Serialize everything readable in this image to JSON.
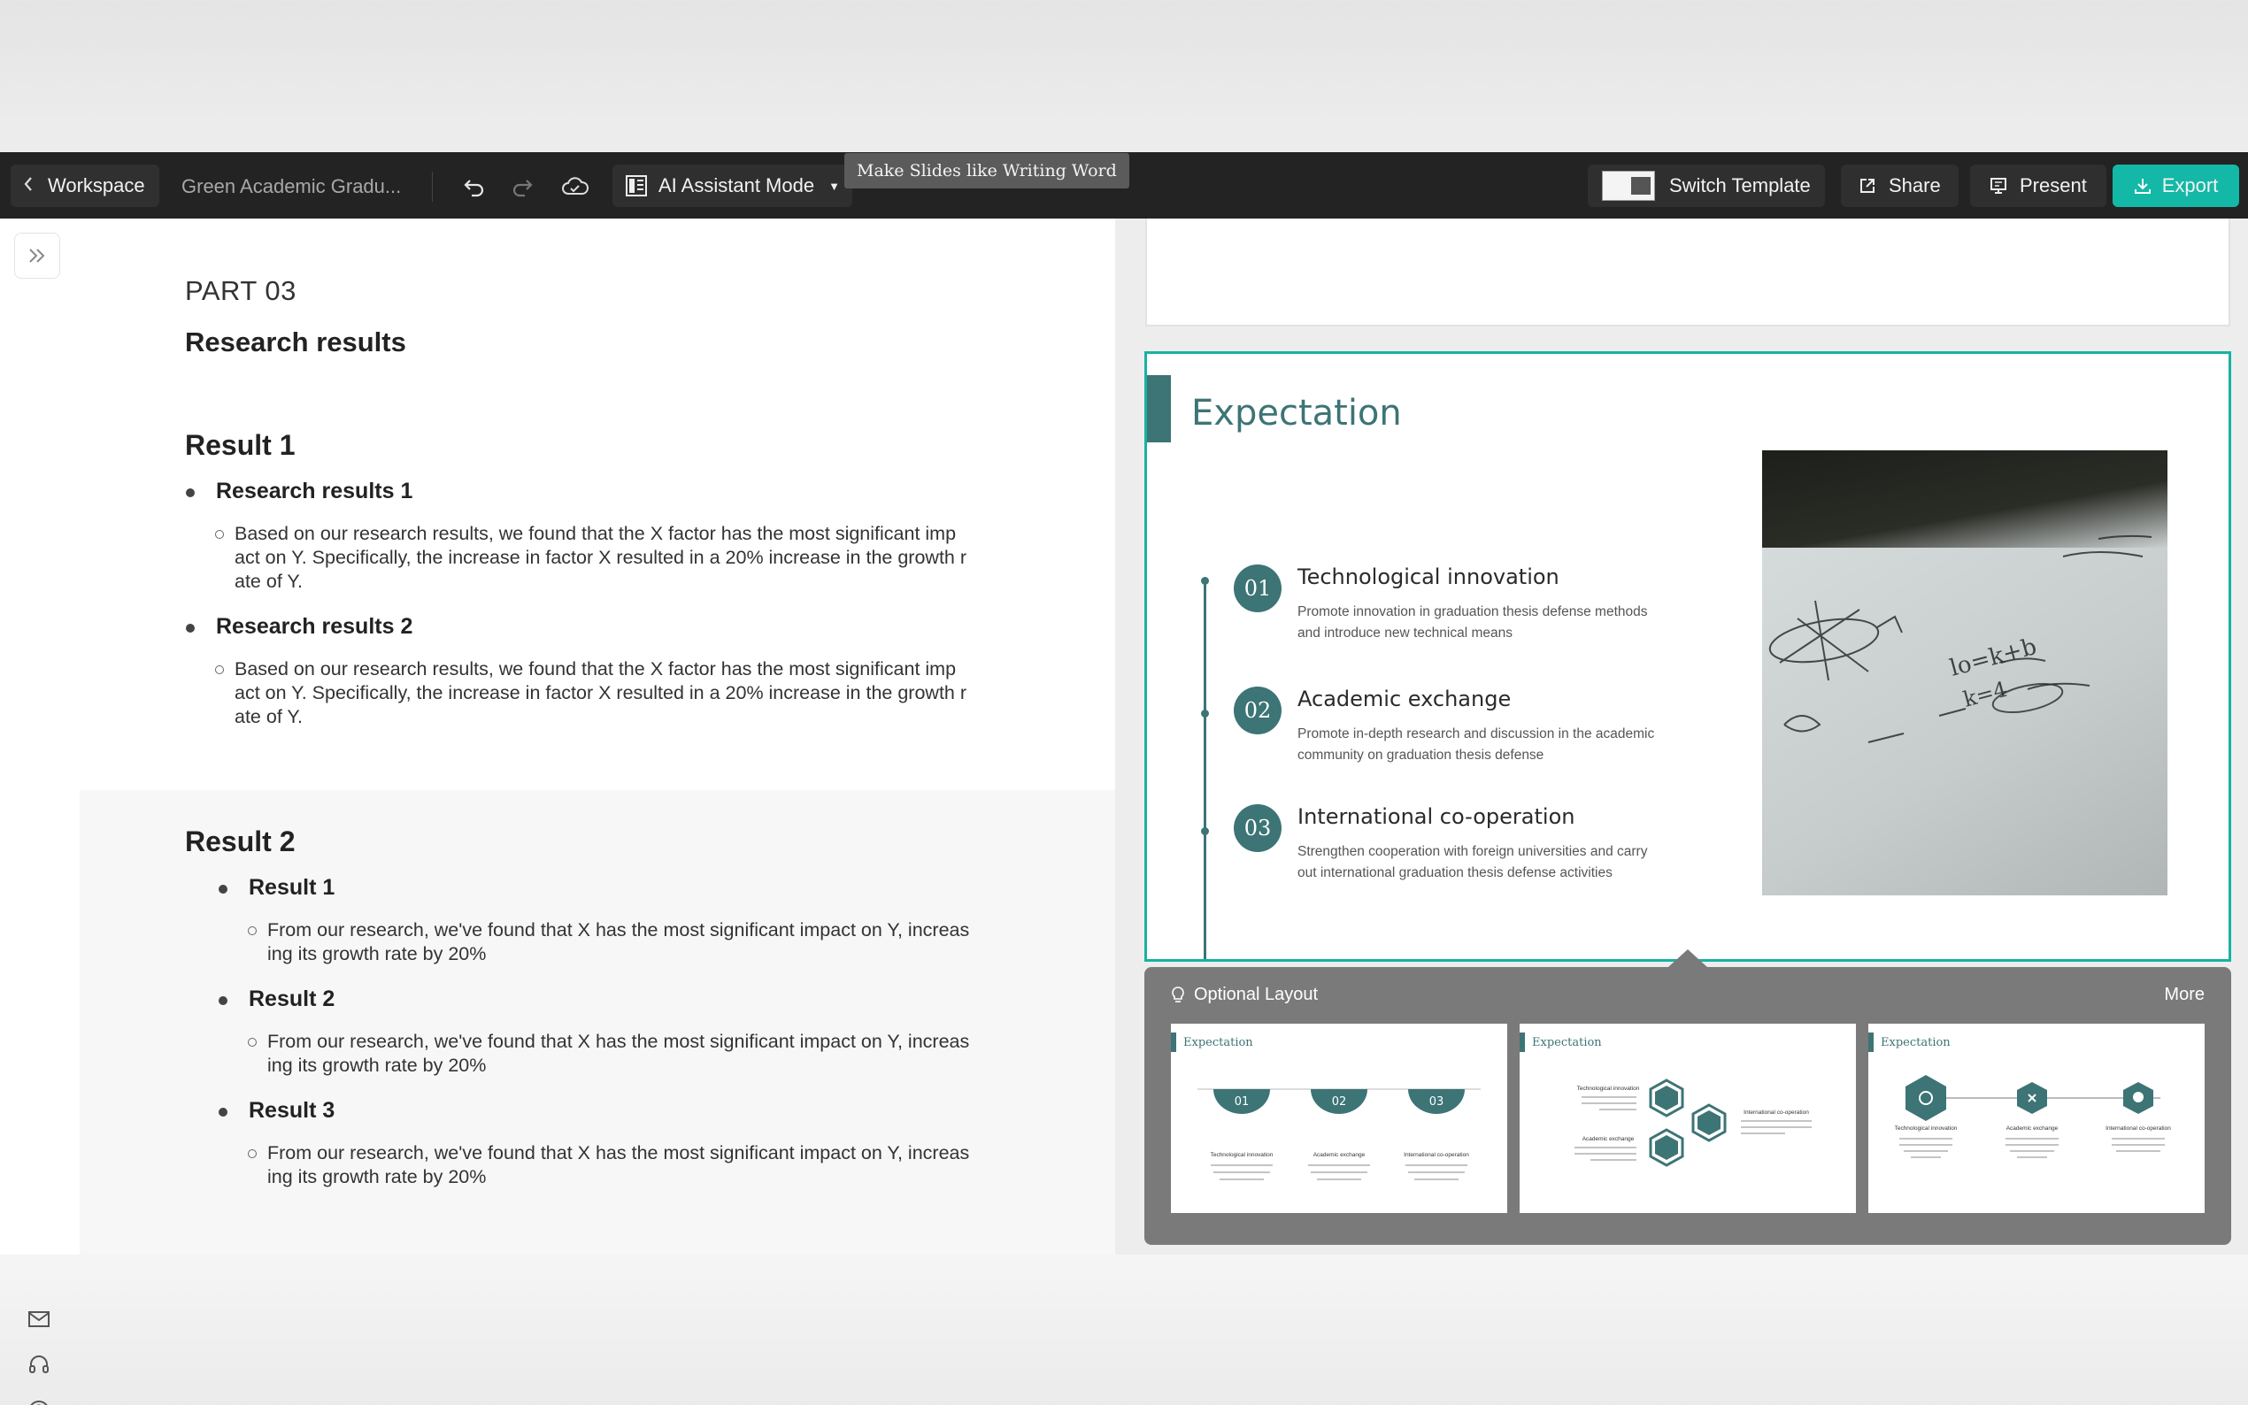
{
  "toolbar": {
    "workspace_label": "Workspace",
    "doc_title": "Green Academic Gradu...",
    "ai_mode_label": "AI Assistant Mode",
    "tooltip": "Make Slides like Writing Word",
    "switch_template_label": "Switch Template",
    "share_label": "Share",
    "present_label": "Present",
    "export_label": "Export",
    "export_color": "#14b8a6"
  },
  "editor": {
    "part_label": "PART 03",
    "section_title": "Research results",
    "result1": {
      "heading": "Result 1",
      "items": [
        {
          "title": "Research results 1",
          "lines": [
            "Based on our research results, we found that the X factor has the most significant imp",
            "act on Y. Specifically, the increase in factor X resulted in a 20% increase in the growth r",
            "ate of Y."
          ]
        },
        {
          "title": "Research results 2",
          "lines": [
            "Based on our research results, we found that the X factor has the most significant imp",
            "act on Y. Specifically, the increase in factor X resulted in a 20% increase in the growth r",
            "ate of Y."
          ]
        }
      ]
    },
    "result2": {
      "heading": "Result 2",
      "items": [
        {
          "title": "Result 1",
          "lines": [
            "From our research, we've found that X has the most significant impact on Y, increas",
            "ing its growth rate by 20%"
          ]
        },
        {
          "title": "Result 2",
          "lines": [
            "From our research, we've found that X has the most significant impact on Y, increas",
            "ing its growth rate by 20%"
          ]
        },
        {
          "title": "Result 3",
          "lines": [
            "From our research, we've found that X has the most significant impact on Y, increas",
            "ing its growth rate by 20%"
          ]
        }
      ]
    }
  },
  "slide": {
    "title": "Expectation",
    "accent_color": "#3d7475",
    "border_color": "#17b2a3",
    "items": [
      {
        "num": "01",
        "title": "Technological innovation",
        "desc": [
          "Promote innovation in graduation thesis defense methods",
          "and introduce new technical means"
        ]
      },
      {
        "num": "02",
        "title": "Academic exchange",
        "desc": [
          "Promote in-depth research and discussion in the academic",
          "community on graduation thesis defense"
        ]
      },
      {
        "num": "03",
        "title": "International co-operation",
        "desc": [
          "Strengthen cooperation with foreign universities and carry",
          "out international graduation thesis defense activities"
        ]
      }
    ],
    "photo_formula_1": "lo=k+b",
    "photo_formula_2": "k=4"
  },
  "layout_panel": {
    "title": "Optional Layout",
    "more_label": "More",
    "cards": [
      {
        "title": "Expectation",
        "nums": [
          "01",
          "02",
          "03"
        ],
        "labels": [
          "Technological innovation",
          "Academic exchange",
          "International co-operation"
        ]
      },
      {
        "title": "Expectation",
        "labels": [
          "Technological innovation",
          "Academic exchange",
          "International co-operation"
        ]
      },
      {
        "title": "Expectation",
        "labels": [
          "Technological innovation",
          "Academic exchange",
          "International co-operation"
        ]
      }
    ]
  },
  "icons": {
    "back": "chevron-left-icon",
    "undo": "undo-icon",
    "redo": "redo-icon",
    "cloud": "cloud-sync-icon",
    "layout": "grid-layout-icon",
    "share": "share-icon",
    "present": "present-icon",
    "export": "download-icon",
    "collapse": "double-chevron-right-icon",
    "mail": "mail-icon",
    "support": "headset-icon",
    "help": "help-icon",
    "lightbulb": "lightbulb-icon"
  }
}
